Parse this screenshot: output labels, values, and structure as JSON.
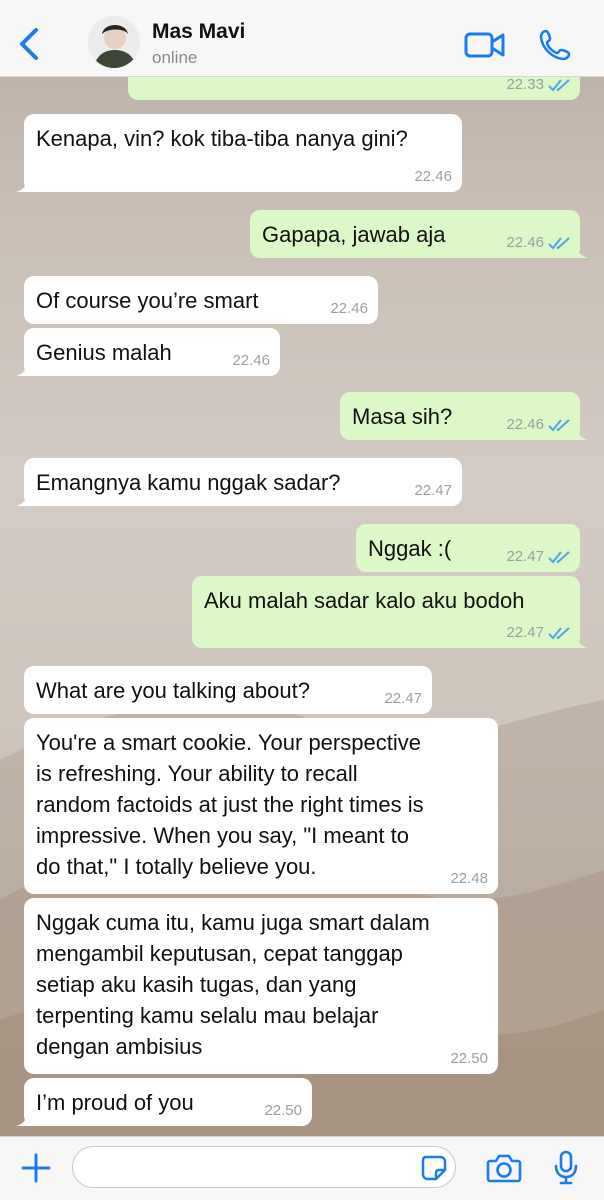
{
  "header": {
    "contact_name": "Mas Mavi",
    "status": "online",
    "icons": [
      "chevron-left-icon",
      "video-icon",
      "phone-icon"
    ]
  },
  "messages": [
    {
      "id": "m0",
      "dir": "out",
      "text": "",
      "time": "22.33",
      "read": true
    },
    {
      "id": "m1",
      "dir": "in",
      "text": "Kenapa, vin? kok tiba-tiba nanya gini?",
      "time": "22.46"
    },
    {
      "id": "m2",
      "dir": "out",
      "text": "Gapapa, jawab aja",
      "time": "22.46",
      "read": true
    },
    {
      "id": "m3",
      "dir": "in",
      "text": "Of course you’re smart",
      "time": "22.46"
    },
    {
      "id": "m4",
      "dir": "in",
      "text": "Genius malah",
      "time": "22.46"
    },
    {
      "id": "m5",
      "dir": "out",
      "text": "Masa sih?",
      "time": "22.46",
      "read": true
    },
    {
      "id": "m6",
      "dir": "in",
      "text": "Emangnya kamu nggak sadar?",
      "time": "22.47"
    },
    {
      "id": "m7",
      "dir": "out",
      "text": "Nggak :(",
      "time": "22.47",
      "read": true
    },
    {
      "id": "m8",
      "dir": "out",
      "text": "Aku malah sadar kalo aku bodoh",
      "time": "22.47",
      "read": true
    },
    {
      "id": "m9",
      "dir": "in",
      "text": "What are you talking about?",
      "time": "22.47"
    },
    {
      "id": "m10",
      "dir": "in",
      "text": "You're a smart cookie. Your perspective\nis refreshing. Your ability to recall\nrandom factoids at just the right times is\nimpressive. When you say, \"I meant to\ndo that,\" I totally believe you.",
      "time": "22.48"
    },
    {
      "id": "m11",
      "dir": "in",
      "text": "Nggak cuma itu, kamu juga smart dalam\nmengambil keputusan, cepat tanggap\nsetiap aku kasih tugas, dan yang\nterpenting kamu selalu mau belajar\ndengan ambisius",
      "time": "22.50"
    },
    {
      "id": "m12",
      "dir": "in",
      "text": "I’m proud of you",
      "time": "22.50"
    }
  ],
  "composer": {
    "input_value": "",
    "placeholder": "",
    "icons": [
      "plus-icon",
      "sticker-icon",
      "camera-icon",
      "microphone-icon"
    ]
  },
  "colors": {
    "accent": "#1a7cf5",
    "outgoing_bubble": "#dcf8c6",
    "incoming_bubble": "#ffffff",
    "read_ticks": "#4fa6e8"
  }
}
